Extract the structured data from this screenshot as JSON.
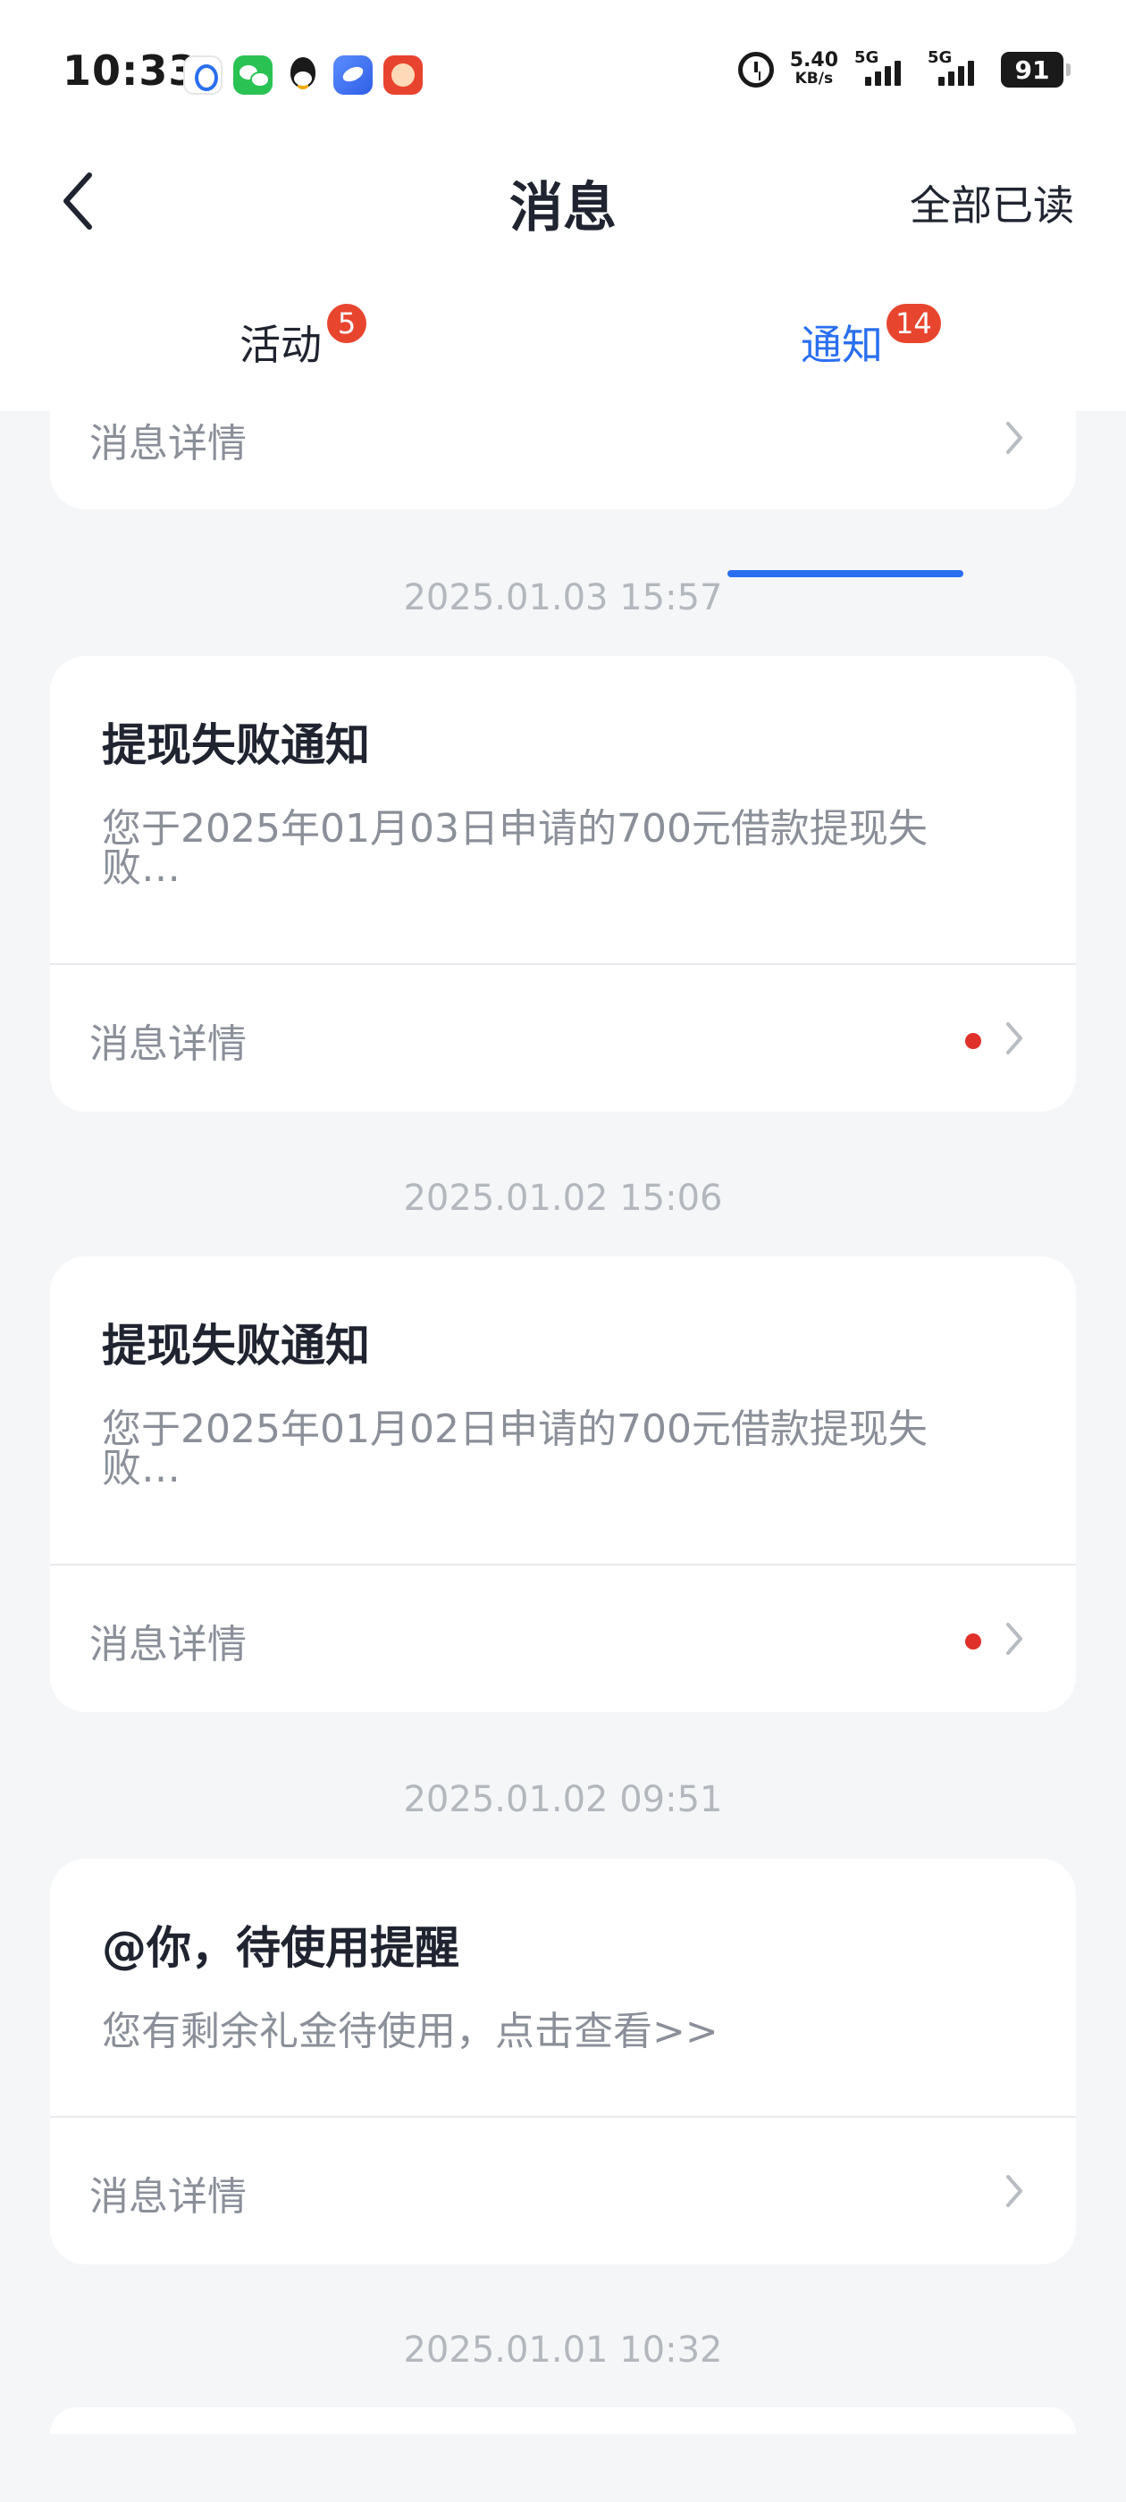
{
  "status": {
    "time": "10:33",
    "net_speed": "5.40",
    "net_unit": "KB/s",
    "signal_1": "5G",
    "signal_2": "5G",
    "battery": "91"
  },
  "header": {
    "title": "消息",
    "mark_all_read": "全部已读"
  },
  "tabs": [
    {
      "label": "活动",
      "badge": "5"
    },
    {
      "label": "通知",
      "badge": "14"
    }
  ],
  "partial_card": {
    "footer": "消息详情"
  },
  "messages": [
    {
      "timestamp": "2025.01.03 15:57",
      "title": "提现失败通知",
      "body": "您于2025年01月03日申请的700元借款提现失败…",
      "footer": "消息详情",
      "unread": true
    },
    {
      "timestamp": "2025.01.02 15:06",
      "title": "提现失败通知",
      "body": "您于2025年01月02日申请的700元借款提现失败…",
      "footer": "消息详情",
      "unread": true
    },
    {
      "timestamp": "2025.01.02 09:51",
      "title": "@你，待使用提醒",
      "body": "您有剩余礼金待使用，点击查看>>",
      "footer": "消息详情",
      "unread": false
    }
  ],
  "last_timestamp": "2025.01.01 10:32",
  "colors": {
    "accent": "#2a6ff0",
    "badge": "#e8452f",
    "unread_dot": "#e0302a"
  }
}
